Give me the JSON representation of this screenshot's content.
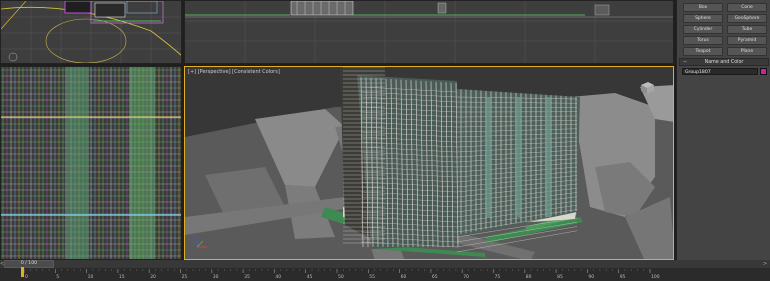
{
  "viewports": {
    "perspective": {
      "bracket_plus": "[+]",
      "view": "[Perspective]",
      "shading": "[Consistent Colors]"
    }
  },
  "command_panel": {
    "primitives": [
      "Box",
      "Cone",
      "Sphere",
      "GeoSphere",
      "Cylinder",
      "Tube",
      "Torus",
      "Pyramid",
      "Teapot",
      "Plane"
    ],
    "rollout_title": "Name and Color",
    "rollout_toggle": "−",
    "object_name": "Group1807",
    "object_color": "#d020a0"
  },
  "timeline": {
    "frame_display": "0 / 100",
    "left_arrow": "<",
    "right_arrow": ">",
    "ticks": [
      "0",
      "5",
      "10",
      "15",
      "20",
      "25",
      "30",
      "35",
      "40",
      "45",
      "50",
      "55",
      "60",
      "65",
      "70",
      "75",
      "80",
      "85",
      "90",
      "95",
      "100"
    ]
  },
  "colors": {
    "active_viewport_border": "#e0b020",
    "building_glass": "#5f8f86",
    "building_frame": "#e8e4da",
    "grass": "#3f8a52"
  }
}
